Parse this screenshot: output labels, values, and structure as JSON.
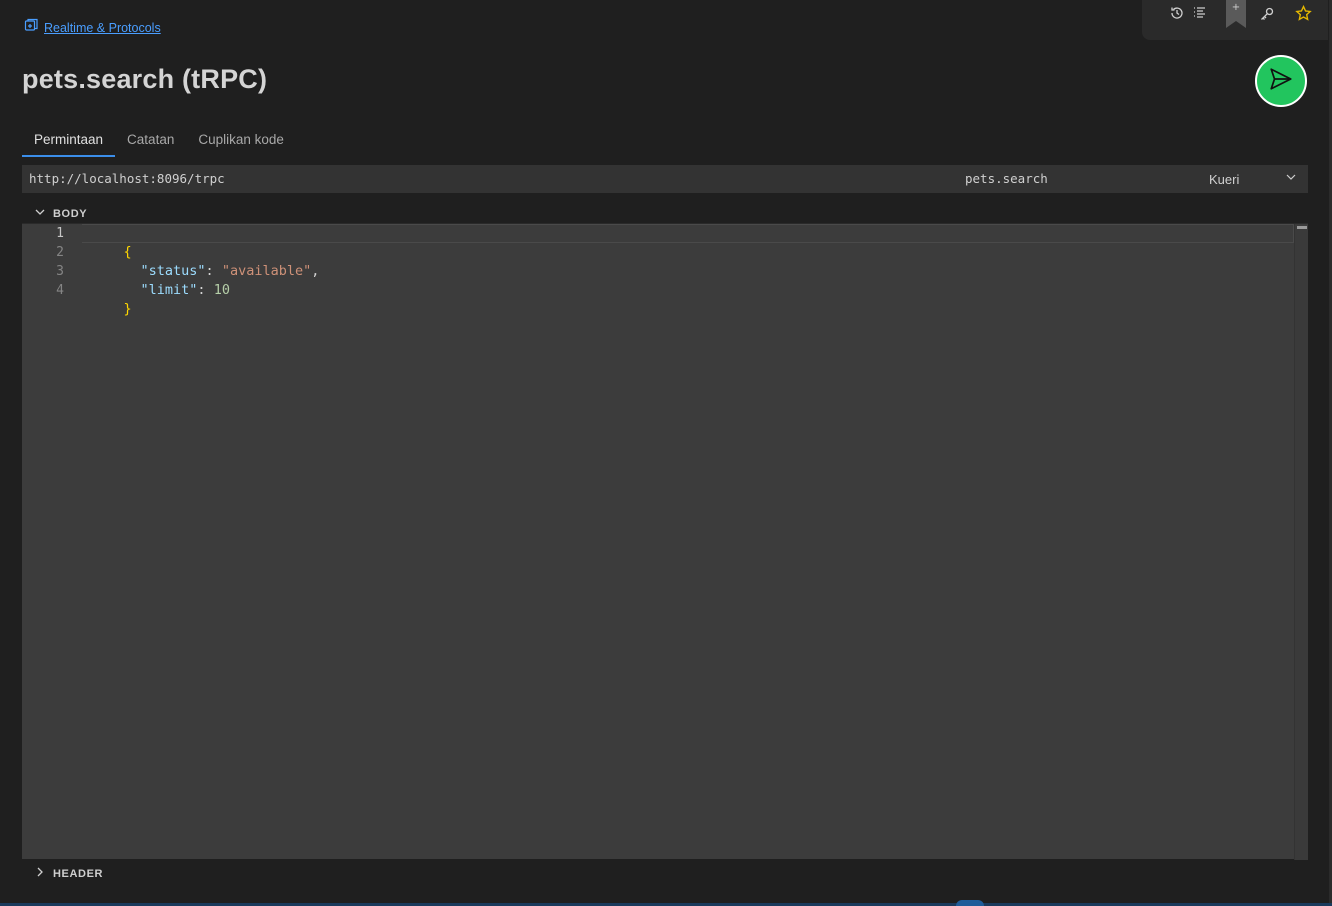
{
  "breadcrumb": {
    "label": "Realtime & Protocols"
  },
  "title": "pets.search (tRPC)",
  "tabs": [
    {
      "label": "Permintaan",
      "active": true
    },
    {
      "label": "Catatan",
      "active": false
    },
    {
      "label": "Cuplikan kode",
      "active": false
    }
  ],
  "request": {
    "url": "http://localhost:8096/trpc",
    "procedure": "pets.search",
    "type": "Kueri"
  },
  "sections": {
    "body_label": "BODY",
    "header_label": "HEADER"
  },
  "editor": {
    "line_numbers": [
      "1",
      "2",
      "3",
      "4"
    ],
    "lines": {
      "l1_open": "{",
      "l2_key": "\"status\"",
      "l2_colon": ": ",
      "l2_value": "\"available\"",
      "l2_comma": ",",
      "l3_key": "\"limit\"",
      "l3_colon": ": ",
      "l3_value": "10",
      "l4_close": "}"
    }
  },
  "toolbar": {
    "icons": [
      "history-icon",
      "list-icon",
      "bookmark-icon",
      "key-icon",
      "star-icon"
    ],
    "bookmark_plus": "+"
  },
  "colors": {
    "accent": "#3b8eea",
    "send": "#22c55e",
    "link": "#4a9eff",
    "star": "#e6b800"
  }
}
